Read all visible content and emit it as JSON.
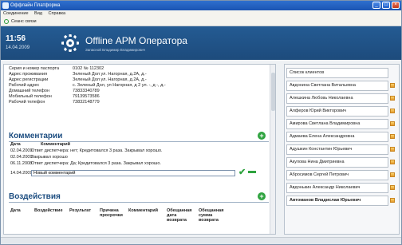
{
  "window": {
    "title": "Оффлайн Платформа"
  },
  "menu": [
    "Соединение",
    "Вид",
    "Справка"
  ],
  "toolbar": {
    "sync_label": "Сеанс связи"
  },
  "header": {
    "time": "11:56",
    "date": "14.04.2009",
    "app_title": "Offline АРМ Оператора",
    "operator": "Запасной Владимир Владимирович"
  },
  "contact": [
    {
      "k": "Серия и номер паспорта",
      "v": "0102 № 112302"
    },
    {
      "k": "Адрес проживания",
      "v": "Зеленый Дол ул. Нагорная, д.2А, д.-"
    },
    {
      "k": "Адрес регистрации",
      "v": "Зеленый Дол ул. Нагорная, д.2А, д.-"
    },
    {
      "k": "Рабочий адрес",
      "v": "с. Зеленый Дол, ул Нагорная, д 2 ул. -, д -, д.-"
    },
    {
      "k": "Домашний телефон",
      "v": "73833340789"
    },
    {
      "k": "Мобильный телефон",
      "v": "79139573586"
    },
    {
      "k": "Рабочий телефон",
      "v": "73832148779"
    }
  ],
  "comments": {
    "title": "Комментарии",
    "col_date": "Дата",
    "col_comment": "Комментарий",
    "rows": [
      {
        "date": "02.04.2009",
        "text": "Ответ диспетчера: нет; Кредитовался 3 раза. Закрывал хорошо."
      },
      {
        "date": "02.04.2009",
        "text": "Закрывал хорошо"
      },
      {
        "date": "06.11.2008",
        "text": "Ответ диспетчера: Да; Кредитовался 3 раза. Закрывал хорошо."
      }
    ],
    "new_date": "14.04.2009",
    "new_value": "Новый комментарий"
  },
  "actions": {
    "title": "Воздействия",
    "columns": [
      "Дата",
      "Воздействие",
      "Результат",
      "Причина просрочки",
      "Комментарий",
      "Обещанная дата возврата",
      "Обещанная сумма возврата"
    ]
  },
  "clients": {
    "header": "Список клиентов",
    "items": [
      "Авдонина Светлана Витальевна",
      "Алешкина Любовь Николаевна",
      "Алферов Юрий Викторович",
      "Амирова Светлана Владимировна",
      "Адмаева Елена Александровна",
      "Адушкин Константин Юрьевич",
      "Акулова Нина Дмитриевна",
      "Абросимов Сергей Петрович",
      "Авдонькин Александр Николаевич",
      "Автоманов Владислав Юрьевич"
    ]
  },
  "colors": {
    "header_bg": "#1d4b7c",
    "accent_green": "#2fa33f",
    "section_title": "#1c4d80"
  }
}
